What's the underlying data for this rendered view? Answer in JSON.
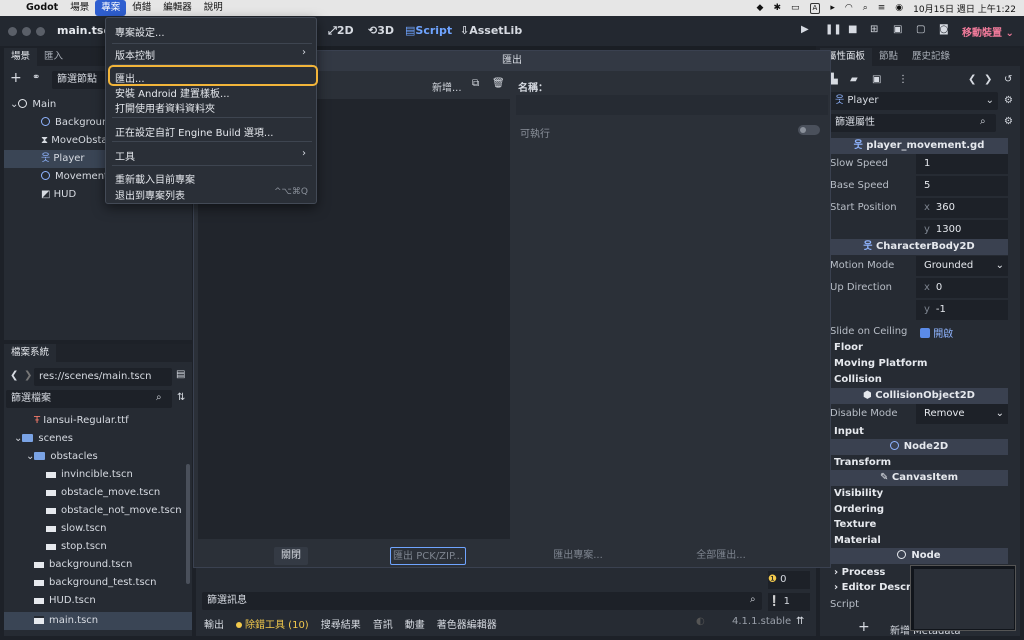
{
  "menubar": {
    "app": "Godot",
    "items": [
      "場景",
      "專案",
      "偵錯",
      "編輯器",
      "說明"
    ],
    "clock": "10月15日 週日 上午1:22"
  },
  "topbar": {
    "scene_tab": "main.tscn",
    "modes": [
      "2D",
      "3D",
      "Script",
      "AssetLib"
    ],
    "deploy": "移動裝置"
  },
  "scene_dock": {
    "tabs": [
      "場景",
      "匯入"
    ],
    "filter_placeholder": "篩選節點",
    "nodes": [
      "Main",
      "Background",
      "MoveObstacle",
      "Player",
      "MovementUI",
      "HUD"
    ]
  },
  "fs_dock": {
    "tab": "檔案系統",
    "path": "res://scenes/main.tscn",
    "filter_placeholder": "篩選檔案",
    "items": [
      "Iansui-Regular.ttf",
      "scenes",
      "obstacles",
      "invincible.tscn",
      "obstacle_move.tscn",
      "obstacle_not_move.tscn",
      "slow.tscn",
      "stop.tscn",
      "background.tscn",
      "background_test.tscn",
      "HUD.tscn",
      "main.tscn"
    ]
  },
  "project_menu": {
    "items": [
      "專案設定...",
      "版本控制",
      "匯出...",
      "安裝 Android 建置樣板...",
      "打開使用者資料資料夾",
      "正在設定自訂 Engine Build 選項...",
      "工具",
      "重新載入目前專案",
      "退出到專案列表"
    ],
    "quit_shortcut": "^⌥⌘Q"
  },
  "export_dialog": {
    "title": "匯出",
    "add_label": "新增...",
    "name_label": "名稱：",
    "runnable_label": "可執行",
    "buttons": [
      "關閉",
      "匯出 PCK/ZIP...",
      "匯出專案...",
      "全部匯出..."
    ]
  },
  "inspector": {
    "tabs": [
      "屬性面板",
      "節點",
      "歷史記錄"
    ],
    "node": "Player",
    "filter_placeholder": "篩選屬性",
    "script_title": "player_movement.gd",
    "slow_speed_label": "Slow Speed",
    "slow_speed": "1",
    "base_speed_label": "Base Speed",
    "base_speed": "5",
    "start_position_label": "Start Position",
    "start_x": "360",
    "start_y": "1300",
    "charbody_title": "CharacterBody2D",
    "motion_mode_label": "Motion Mode",
    "motion_mode": "Grounded",
    "up_direction_label": "Up Direction",
    "up_x": "0",
    "up_y": "-1",
    "slide_label": "Slide on Ceiling",
    "slide_value": "開啟",
    "groups1": [
      "Floor",
      "Moving Platform",
      "Collision"
    ],
    "collision_title": "CollisionObject2D",
    "disable_mode_label": "Disable Mode",
    "disable_mode": "Remove",
    "input_label": "Input",
    "node2d_title": "Node2D",
    "transform_label": "Transform",
    "canvas_title": "CanvasItem",
    "groups2": [
      "Visibility",
      "Ordering",
      "Texture",
      "Material"
    ],
    "node_title": "Node",
    "groups3": [
      "Process",
      "Editor Description"
    ],
    "script_label": "Script",
    "add_metadata": "新增 Metadata"
  },
  "bottom": {
    "filter_placeholder": "篩選訊息",
    "tabs": [
      "輸出",
      "除錯工具 (10)",
      "搜尋結果",
      "音訊",
      "動畫",
      "著色器編輯器"
    ],
    "error_count": "0",
    "warn_count": "1",
    "version": "4.1.1.stable"
  },
  "colors": {
    "accent": "#6fa4ff",
    "highlight": "#f2b53a",
    "deploy": "#f07a9a"
  }
}
